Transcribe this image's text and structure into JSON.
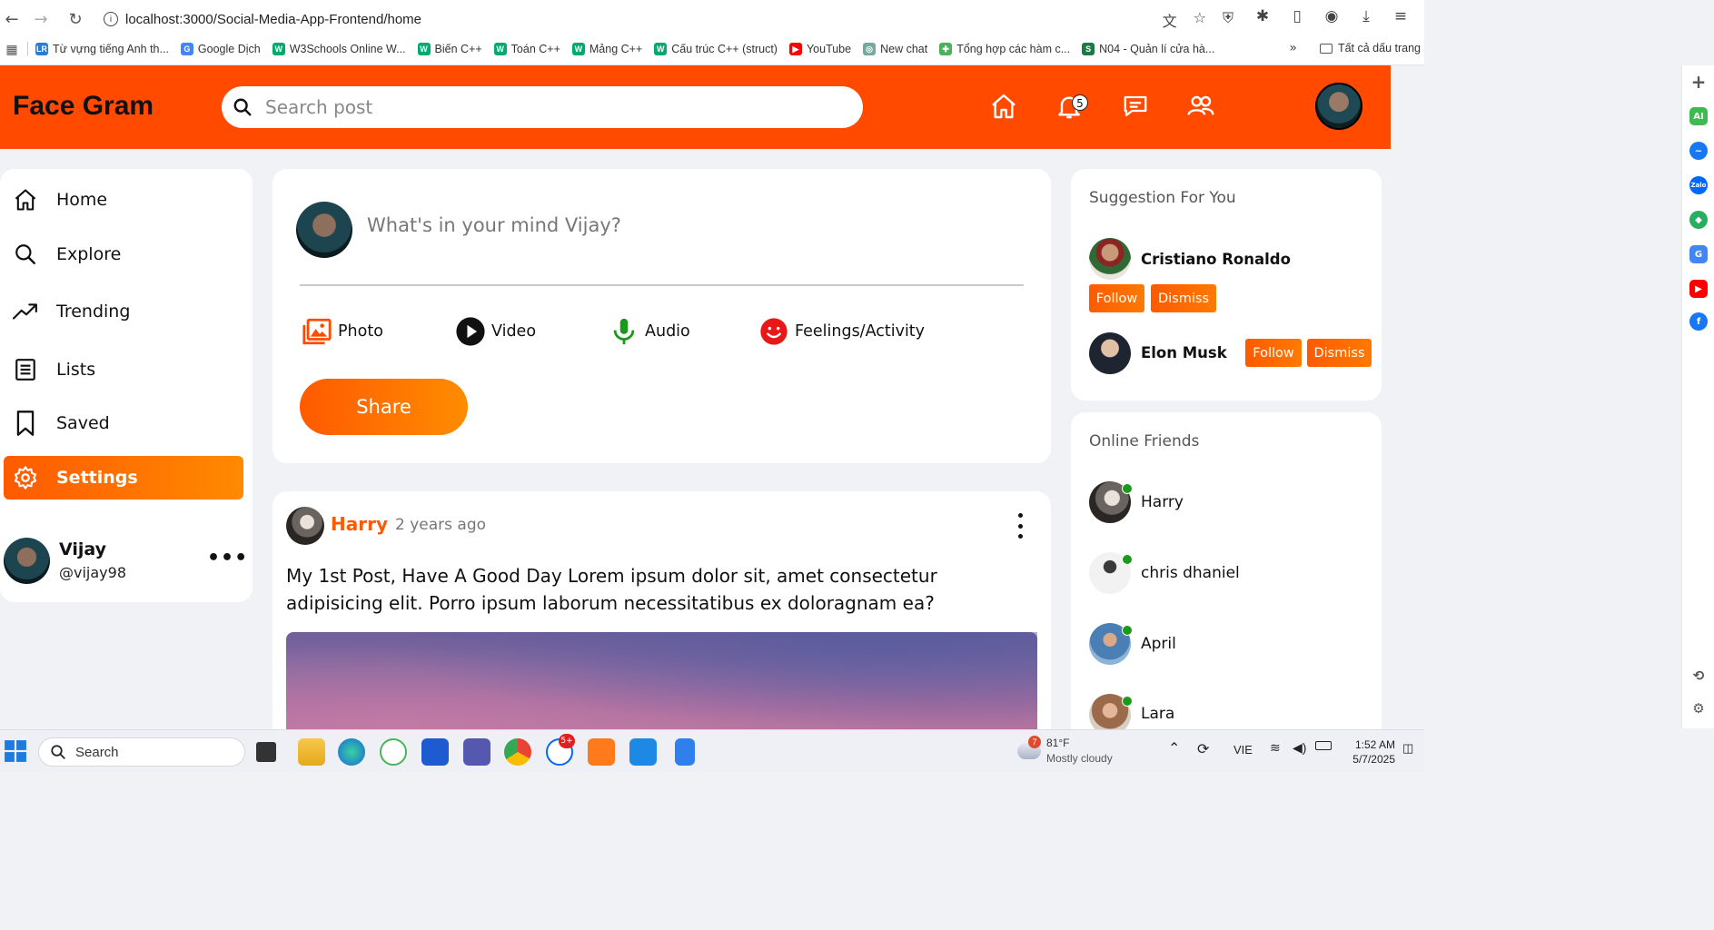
{
  "browser": {
    "url": "localhost:3000/Social-Media-App-Frontend/home",
    "bookmarks": [
      {
        "label": "Từ vựng tiếng Anh th...",
        "color": "#2b7bd6",
        "glyph": "LR"
      },
      {
        "label": "Google Dịch",
        "color": "#4285f4",
        "glyph": "G"
      },
      {
        "label": "W3Schools Online W...",
        "color": "#04aa6d",
        "glyph": "W"
      },
      {
        "label": "Biến C++",
        "color": "#04aa6d",
        "glyph": "W"
      },
      {
        "label": "Toán C++",
        "color": "#04aa6d",
        "glyph": "W"
      },
      {
        "label": "Mảng C++",
        "color": "#04aa6d",
        "glyph": "W"
      },
      {
        "label": "Cấu trúc C++ (struct)",
        "color": "#04aa6d",
        "glyph": "W"
      },
      {
        "label": "YouTube",
        "color": "#ff0000",
        "glyph": "▶"
      },
      {
        "label": "New chat",
        "color": "#74aa9c",
        "glyph": "◎"
      },
      {
        "label": "Tổng hợp các hàm c...",
        "color": "#49b35a",
        "glyph": "✚"
      },
      {
        "label": "N04 - Quản lí cửa hà...",
        "color": "#1e7a45",
        "glyph": "S"
      }
    ],
    "all_bookmarks": "Tất cả dấu trang"
  },
  "app": {
    "logo": "Face Gram",
    "search_placeholder": "Search post",
    "notification_count": "5"
  },
  "sidebar": {
    "items": [
      {
        "label": "Home",
        "icon": "home-icon"
      },
      {
        "label": "Explore",
        "icon": "search-icon"
      },
      {
        "label": "Trending",
        "icon": "trending-icon"
      },
      {
        "label": "Lists",
        "icon": "list-icon"
      },
      {
        "label": "Saved",
        "icon": "bookmark-icon"
      },
      {
        "label": "Settings",
        "icon": "gear-icon",
        "active": true
      }
    ],
    "profile": {
      "name": "Vijay",
      "handle": "@vijay98"
    }
  },
  "composer": {
    "placeholder": "What's in your mind Vijay?",
    "options": [
      "Photo",
      "Video",
      "Audio",
      "Feelings/Activity"
    ],
    "share_label": "Share"
  },
  "post": {
    "author": "Harry",
    "time": "2 years ago",
    "text": "My 1st Post, Have A Good Day Lorem ipsum dolor sit, amet consectetur adipisicing elit. Porro ipsum laborum necessitatibus ex doloragnam ea?"
  },
  "suggestions": {
    "title": "Suggestion For You",
    "people": [
      {
        "name": "Cristiano Ronaldo",
        "follow": "Follow",
        "dismiss": "Dismiss"
      },
      {
        "name": "Elon Musk",
        "follow": "Follow",
        "dismiss": "Dismiss"
      }
    ]
  },
  "online": {
    "title": "Online Friends",
    "friends": [
      "Harry",
      "chris dhaniel",
      "April",
      "Lara"
    ]
  },
  "taskbar": {
    "search": "Search",
    "weather_temp": "81°F",
    "weather_desc": "Mostly cloudy",
    "weather_badge": "7",
    "zalo_badge": "5+",
    "lang": "VIE",
    "time": "1:52 AM",
    "date": "5/7/2025"
  },
  "colors": {
    "accent": "#ff4a00",
    "accent2": "#ff8a00",
    "online": "#1a9a1a"
  }
}
